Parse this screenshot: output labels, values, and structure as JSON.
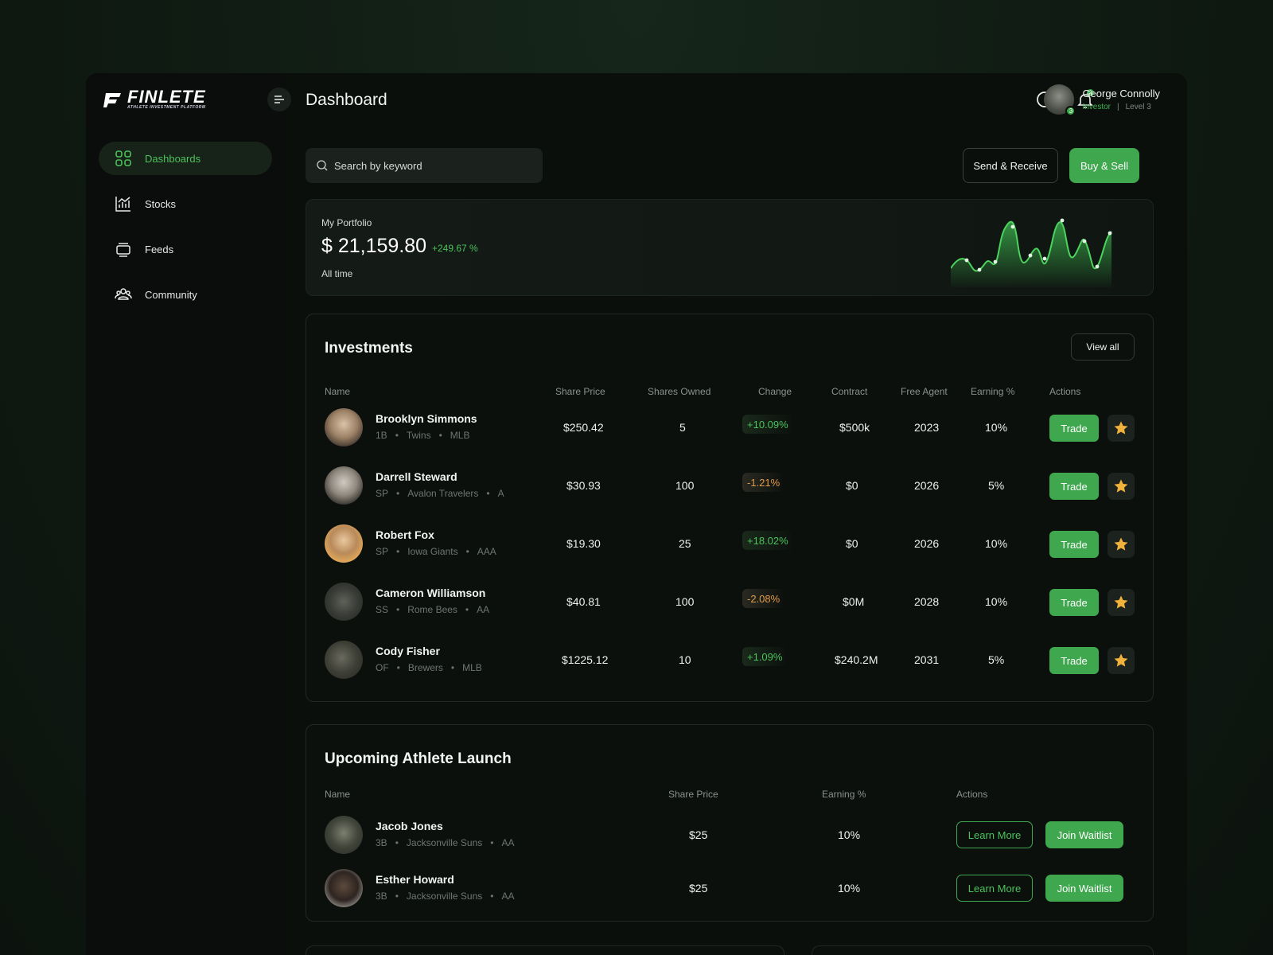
{
  "brand": {
    "name": "FINLETE",
    "tagline": "ATHLETE INVESTMENT PLATFORM"
  },
  "sidebar": {
    "items": [
      {
        "label": "Dashboards",
        "icon": "dashboard-grid-icon",
        "active": true
      },
      {
        "label": "Stocks",
        "icon": "chart-icon",
        "active": false
      },
      {
        "label": "Feeds",
        "icon": "feeds-icon",
        "active": false
      },
      {
        "label": "Community",
        "icon": "community-icon",
        "active": false
      }
    ]
  },
  "header": {
    "title": "Dashboard",
    "notification_count": "2",
    "user": {
      "name": "George Connolly",
      "role": "Investor",
      "level": "Level 3",
      "badge": "3"
    }
  },
  "toolbar": {
    "search_placeholder": "Search by keyword",
    "send_receive_label": "Send & Receive",
    "buy_sell_label": "Buy & Sell"
  },
  "portfolio": {
    "label": "My Portfolio",
    "value": "$ 21,159.80",
    "change": "+249.67 %",
    "period": "All time"
  },
  "investments": {
    "title": "Investments",
    "view_all_label": "View all",
    "columns": [
      "Name",
      "Share Price",
      "Shares Owned",
      "Change",
      "Contract",
      "Free Agent",
      "Earning %",
      "Actions"
    ],
    "trade_label": "Trade",
    "rows": [
      {
        "name": "Brooklyn Simmons",
        "pos": "1B",
        "team": "Twins",
        "league": "MLB",
        "price": "$250.42",
        "shares": "5",
        "change": "+10.09%",
        "dir": "up",
        "contract": "$500k",
        "free_agent": "2023",
        "earning": "10%"
      },
      {
        "name": "Darrell Steward",
        "pos": "SP",
        "team": "Avalon Travelers",
        "league": "A",
        "price": "$30.93",
        "shares": "100",
        "change": "-1.21%",
        "dir": "down",
        "contract": "$0",
        "free_agent": "2026",
        "earning": "5%"
      },
      {
        "name": "Robert Fox",
        "pos": "SP",
        "team": "Iowa Giants",
        "league": "AAA",
        "price": "$19.30",
        "shares": "25",
        "change": "+18.02%",
        "dir": "up",
        "contract": "$0",
        "free_agent": "2026",
        "earning": "10%"
      },
      {
        "name": "Cameron Williamson",
        "pos": "SS",
        "team": "Rome Bees",
        "league": "AA",
        "price": "$40.81",
        "shares": "100",
        "change": "-2.08%",
        "dir": "down",
        "contract": "$0M",
        "free_agent": "2028",
        "earning": "10%"
      },
      {
        "name": "Cody Fisher",
        "pos": "OF",
        "team": "Brewers",
        "league": "MLB",
        "price": "$1225.12",
        "shares": "10",
        "change": "+1.09%",
        "dir": "up",
        "contract": "$240.2M",
        "free_agent": "2031",
        "earning": "5%"
      }
    ]
  },
  "upcoming": {
    "title": "Upcoming Athlete Launch",
    "columns": [
      "Name",
      "Share Price",
      "Earning %",
      "Actions"
    ],
    "learn_label": "Learn More",
    "join_label": "Join Waitlist",
    "rows": [
      {
        "name": "Jacob Jones",
        "pos": "3B",
        "team": "Jacksonville Suns",
        "league": "AA",
        "price": "$25",
        "earning": "10%"
      },
      {
        "name": "Esther Howard",
        "pos": "3B",
        "team": "Jacksonville Suns",
        "league": "AA",
        "price": "$25",
        "earning": "10%"
      }
    ]
  },
  "colors": {
    "accent": "#3fa74e",
    "accent_text": "#4cc25a",
    "negative": "#e09a4a",
    "background": "#0b0f0c"
  }
}
